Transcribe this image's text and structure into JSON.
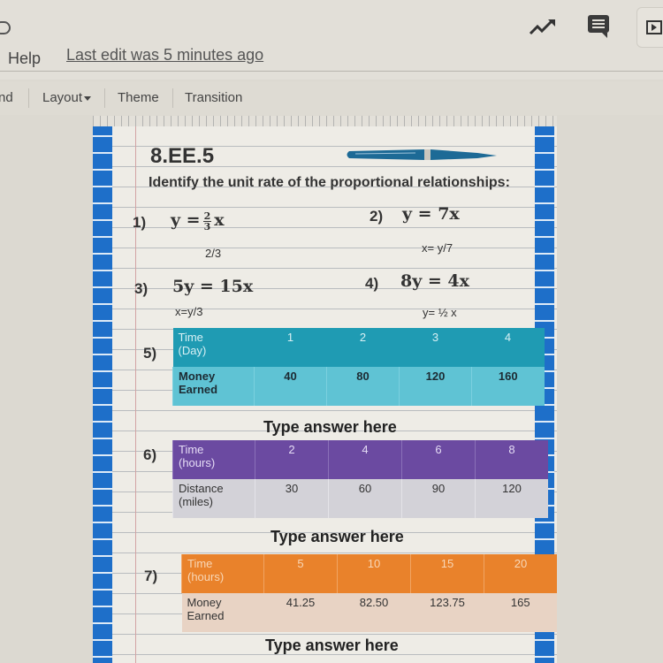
{
  "app": {
    "menu_help": "Help",
    "last_edit": "Last edit was 5 minutes ago",
    "icons": [
      "cloud-icon",
      "activity-trend-icon",
      "comment-icon",
      "present-icon"
    ]
  },
  "toolbar": {
    "items": [
      {
        "label": "nd"
      },
      {
        "label": "Layout",
        "has_dropdown": true
      },
      {
        "label": "Theme"
      },
      {
        "label": "Transition"
      }
    ]
  },
  "slide": {
    "standard": "8.EE.5",
    "instructions": "Identify the unit rate of the proportional relationships:",
    "problems": [
      {
        "num": "1)",
        "lhs": "y =",
        "frac_num": "2",
        "frac_den": "3",
        "rhs": "x",
        "answer": "2/3"
      },
      {
        "num": "2)",
        "equation": "y = 7x",
        "answer": "x= y/7"
      },
      {
        "num": "3)",
        "equation": "5y = 15x",
        "answer": "x=y/3"
      },
      {
        "num": "4)",
        "equation": "8y = 4x",
        "answer": "y= ½ x"
      }
    ],
    "tables": [
      {
        "num": "5)",
        "header_label": [
          "Time",
          "(Day)"
        ],
        "header_values": [
          "1",
          "2",
          "3",
          "4"
        ],
        "row_label": [
          "Money",
          "Earned"
        ],
        "row_values": [
          "40",
          "80",
          "120",
          "160"
        ],
        "color": "#1f9bb3",
        "answer_placeholder": "Type answer here"
      },
      {
        "num": "6)",
        "header_label": [
          "Time",
          "(hours)"
        ],
        "header_values": [
          "2",
          "4",
          "6",
          "8"
        ],
        "row_label": [
          "Distance",
          "(miles)"
        ],
        "row_values": [
          "30",
          "60",
          "90",
          "120"
        ],
        "color": "#6b4aa1",
        "answer_placeholder": "Type answer here"
      },
      {
        "num": "7)",
        "header_label": [
          "Time",
          "(hours)"
        ],
        "header_values": [
          "5",
          "10",
          "15",
          "20"
        ],
        "row_label": [
          "Money",
          "Earned"
        ],
        "row_values": [
          "41.25",
          "82.50",
          "123.75",
          "165"
        ],
        "color": "#e9822b",
        "answer_placeholder": "Type answer here"
      }
    ]
  }
}
